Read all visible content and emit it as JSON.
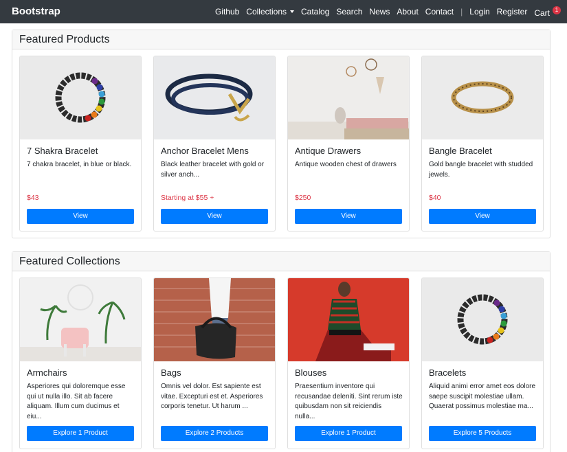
{
  "nav": {
    "brand": "Bootstrap",
    "links": [
      "Github",
      "Collections",
      "Catalog",
      "Search",
      "News",
      "About",
      "Contact"
    ],
    "separator": "|",
    "login": "Login",
    "register": "Register",
    "cart": "Cart",
    "cart_count": "1"
  },
  "featured_products": {
    "heading": "Featured Products",
    "items": [
      {
        "title": "7 Shakra Bracelet",
        "description": "7 chakra bracelet, in blue or black.",
        "price": "$43",
        "button": "View"
      },
      {
        "title": "Anchor Bracelet Mens",
        "description": "Black leather bracelet with gold or silver anch...",
        "price": "Starting at $55 +",
        "button": "View"
      },
      {
        "title": "Antique Drawers",
        "description": "Antique wooden chest of drawers",
        "price": "$250",
        "button": "View"
      },
      {
        "title": "Bangle Bracelet",
        "description": "Gold bangle bracelet with studded jewels.",
        "price": "$40",
        "button": "View"
      }
    ]
  },
  "featured_collections": {
    "heading": "Featured Collections",
    "items": [
      {
        "title": "Armchairs",
        "description": "Asperiores qui doloremque esse qui ut nulla illo. Sit ab facere aliquam. Illum cum ducimus et eiu...",
        "button": "Explore 1 Product"
      },
      {
        "title": "Bags",
        "description": "Omnis vel dolor. Est sapiente est vitae. Excepturi est et. Asperiores corporis tenetur. Ut harum ...",
        "button": "Explore 2 Products"
      },
      {
        "title": "Blouses",
        "description": "Praesentium inventore qui recusandae deleniti. Sint rerum iste quibusdam non sit reiciendis nulla...",
        "button": "Explore 1 Product"
      },
      {
        "title": "Bracelets",
        "description": "Aliquid animi error amet eos dolore saepe suscipit molestiae ullam. Quaerat possimus molestiae ma...",
        "button": "Explore 5 Products"
      }
    ]
  },
  "colors": {
    "navbar": "#343a40",
    "primary": "#007bff",
    "price": "#dc3545"
  }
}
